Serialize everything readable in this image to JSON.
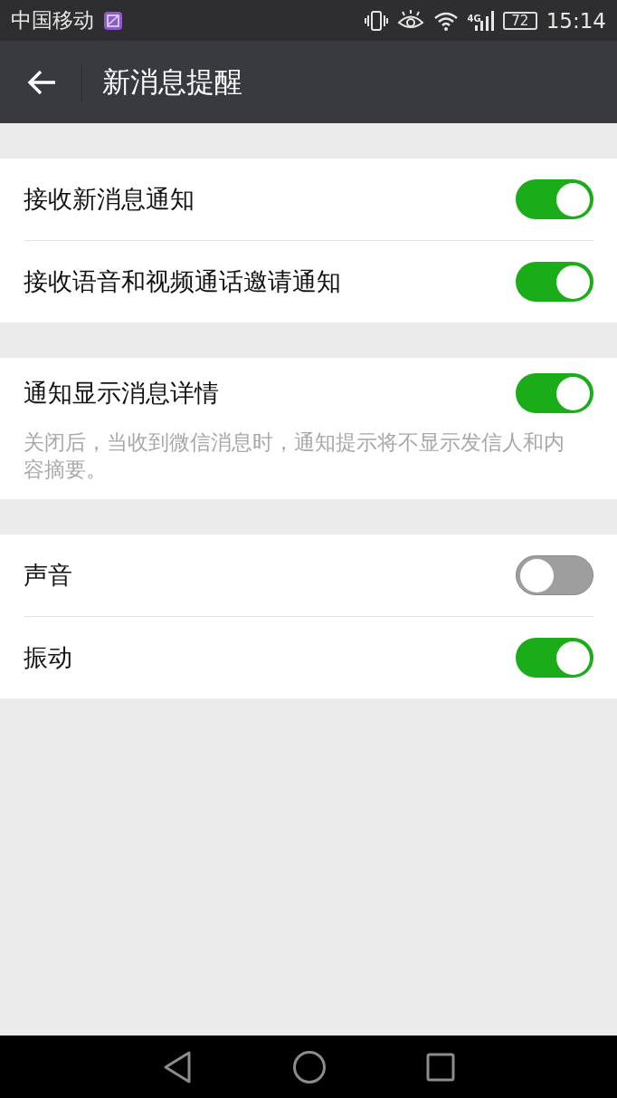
{
  "status_bar": {
    "carrier": "中国移动",
    "network": "4G",
    "battery": "72",
    "time": "15:14"
  },
  "header": {
    "title": "新消息提醒"
  },
  "groups": [
    {
      "items": [
        {
          "label": "接收新消息通知",
          "on": true
        },
        {
          "label": "接收语音和视频通话邀请通知",
          "on": true
        }
      ]
    },
    {
      "items": [
        {
          "label": "通知显示消息详情",
          "on": true,
          "description": "关闭后，当收到微信消息时，通知提示将不显示发信人和内容摘要。"
        }
      ]
    },
    {
      "items": [
        {
          "label": "声音",
          "on": false
        },
        {
          "label": "振动",
          "on": true
        }
      ]
    }
  ]
}
